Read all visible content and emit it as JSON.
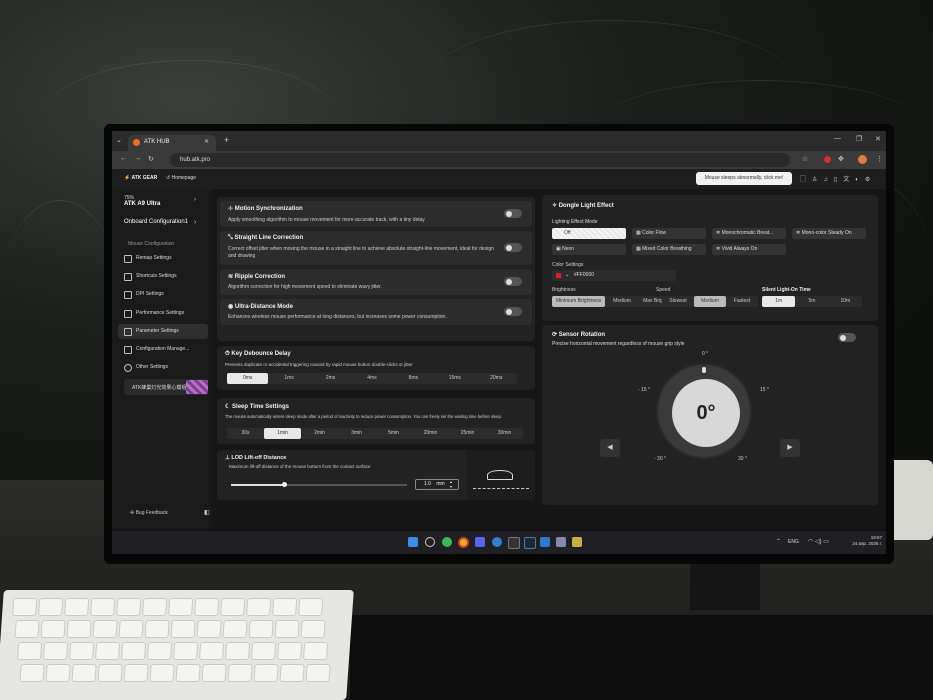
{
  "browser": {
    "tab_title": "ATK HUB",
    "url": "hub.atk.pro"
  },
  "header": {
    "brand": "ATK GEAR",
    "home": "Homepage",
    "notice_button": "Mouse sleeps abnormally, click me!"
  },
  "device": {
    "battery": "75%",
    "name": "ATK A9 Ultra",
    "config": "Onboard Configuration1"
  },
  "sidebar": {
    "section_label": "Mouse Configuration",
    "items": [
      {
        "label": "Remap Settings"
      },
      {
        "label": "Shortcuts Settings"
      },
      {
        "label": "DPI Settings"
      },
      {
        "label": "Performance Settings"
      },
      {
        "label": "Parameter Settings"
      },
      {
        "label": "Configuration Manage..."
      },
      {
        "label": "Other Settings"
      }
    ],
    "promo": "ATK蜂巢灯光效果心模组",
    "feedback": "Bug Feedback"
  },
  "toggles": [
    {
      "title": "Motion Synchronization",
      "desc": "Apply smoothing algorithm to mouse movement for more accurate track, with a tiny delay",
      "on": false
    },
    {
      "title": "Straight Line Correction",
      "desc": "Correct offset jitter when moving the mouse in a straight line to achieve absolute straight-line movement, ideal for design and drawing",
      "on": false
    },
    {
      "title": "Ripple Correction",
      "desc": "Algorithm correction for high movement speed to eliminate wavy jitter.",
      "on": false
    },
    {
      "title": "Ultra-Distance Mode",
      "desc": "Enhances wireless mouse performance at long distances, but increases some power consumption.",
      "on": false
    }
  ],
  "debounce": {
    "title": "Key Debounce Delay",
    "desc": "Prevents duplicate or accidental triggering caused by rapid mouse button double-clicks or jitter",
    "options": [
      "0ms",
      "1ms",
      "2ms",
      "4ms",
      "8ms",
      "15ms",
      "20ms"
    ],
    "selected": "0ms"
  },
  "sleep": {
    "title": "Sleep Time Settings",
    "desc": "The mouse automatically enters sleep mode after a period of inactivity to reduce power consumption. You can freely set the waiting time before sleep.",
    "options": [
      "30s",
      "1min",
      "2min",
      "3min",
      "5min",
      "20min",
      "25min",
      "30min"
    ],
    "selected": "1min"
  },
  "lod": {
    "title": "LOD Lift-off Distance",
    "desc": "Maximum lift-off distance of the mouse bottom from the contact surface",
    "value": "1.0",
    "unit": "mm",
    "level": 0.3
  },
  "dongle": {
    "title": "Dongle Light Effect",
    "mode_label": "Lighting Effect Mode",
    "modes": [
      "Off",
      "Color Flow",
      "Monochromatic Breat...",
      "Mono-color Steady On",
      "Neon",
      "Mixed Color Breathing",
      "Vivid Always On"
    ],
    "selected_mode": "Off",
    "color_label": "Color Settings",
    "color_value": "#FF0000",
    "color": "#e02020",
    "brightness_label": "Brightness",
    "brightness_options": [
      "Minimum Brightness",
      "Medium",
      "Max Brightness"
    ],
    "brightness_selected": "Minimum Brightness",
    "speed_label": "Speed",
    "speed_options": [
      "Slowest",
      "Medium",
      "Fastest"
    ],
    "speed_selected": "Medium",
    "silent_label": "Silent Light-On Time",
    "silent_options": [
      "1m",
      "5m",
      "10m"
    ],
    "silent_selected": "1m"
  },
  "rotation": {
    "title": "Sensor Rotation",
    "desc": "Precise horizontal movement regardless of mouse grip style",
    "value": "0°",
    "ticks": {
      "top": "0 °",
      "left15": "- 15 °",
      "right15": "15 °",
      "left30": "- 30 °",
      "right30": "30 °"
    }
  },
  "taskbar": {
    "lang": "ENG",
    "time": "19:57",
    "date": "24 апр. 2026 г."
  }
}
